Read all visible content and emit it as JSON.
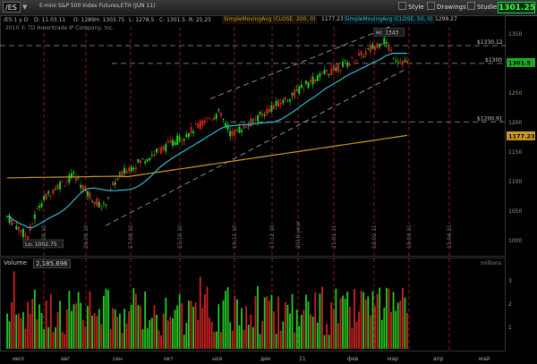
{
  "toolbar": {
    "symbol": "/ES",
    "description": "E-mini S&P 500 Index Futures,ETH (JUN 11)",
    "style_label": "Style",
    "drawings_label": "Drawings",
    "studies_label": "Studies",
    "last_price": "1301.25"
  },
  "legend": {
    "period": "/ES 1 y D",
    "d": "D: 11.03.11",
    "o": "O: 1289",
    "h": "H: 1303.75",
    "l": "L: 1278.5",
    "c": "C: 1301.5",
    "r": "R: 25.25",
    "sma200_label": "SimpleMovingAvg (CLOSE, 200, 0)",
    "sma200_value": "1177.23",
    "sma50_label": "SimpleMovingAvg (CLOSE, 50, 0)",
    "sma50_value": "1299.27"
  },
  "copyright": "2010 © TD Ameritrade IP Company, Inc.",
  "price_axis": {
    "ticks": [
      "1350",
      "1300",
      "1250",
      "1200",
      "1150",
      "1100",
      "1050",
      "1000"
    ],
    "tag_last": "1301.5",
    "tag_sma200": "1177.23"
  },
  "annotations": {
    "high": "Hi: 1343",
    "low": "Lo: 1002.75",
    "level1": "$1330.12",
    "level2": "$1300",
    "level3": "$1200.91"
  },
  "date_markers": [
    "31.08.10",
    "28.09.10",
    "17.09.10",
    "15.10.10",
    "19.11.10",
    "17.12.10",
    "2010 year",
    "21.01.11",
    "18.02.11",
    "18.03.11",
    "15.04.11"
  ],
  "x_axis": [
    "июл",
    "авг",
    "сен",
    "окт",
    "ноя",
    "дек",
    "11",
    "фев",
    "мар",
    "апр",
    "май"
  ],
  "volume": {
    "title": "Volume",
    "value": "2,185,696",
    "unit": "millions",
    "ticks": [
      "3",
      "2",
      "1"
    ]
  },
  "colors": {
    "up": "#22cc22",
    "down": "#cc2222",
    "sma50": "#33bbcc",
    "sma200": "#cc9922",
    "marker": "#aa2222",
    "level": "#888888"
  },
  "chart_data": {
    "type": "candlestick",
    "ylim": [
      980,
      1365
    ],
    "series_hint": "daily S&P 500 E-mini futures, Jul 2010 - Mar 2011"
  }
}
